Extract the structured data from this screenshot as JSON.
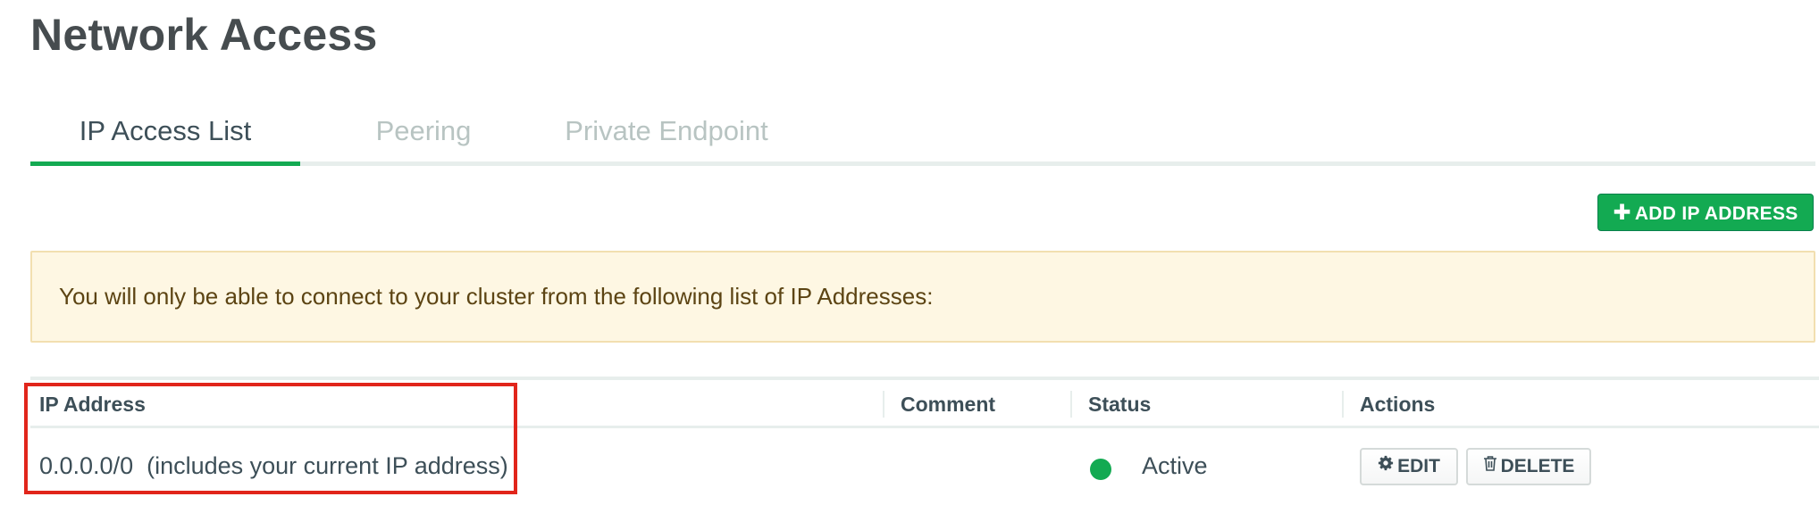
{
  "page": {
    "title": "Network Access"
  },
  "tabs": [
    {
      "label": "IP Access List",
      "active": true
    },
    {
      "label": "Peering",
      "active": false
    },
    {
      "label": "Private Endpoint",
      "active": false
    }
  ],
  "toolbar": {
    "add_ip_label": "ADD IP ADDRESS",
    "add_icon": "plus-icon"
  },
  "banner": {
    "text": "You will only be able to connect to your cluster from the following list of IP Addresses:"
  },
  "table": {
    "columns": [
      "IP Address",
      "Comment",
      "Status",
      "Actions"
    ],
    "rows": [
      {
        "ip": "0.0.0.0/0  (includes your current IP address)",
        "comment": "",
        "status": "Active",
        "status_color": "#13aa52",
        "actions": {
          "edit": "EDIT",
          "delete": "DELETE"
        }
      }
    ]
  },
  "colors": {
    "accent": "#13aa52",
    "highlight": "#e1251b",
    "banner_bg": "#fef7e3"
  }
}
